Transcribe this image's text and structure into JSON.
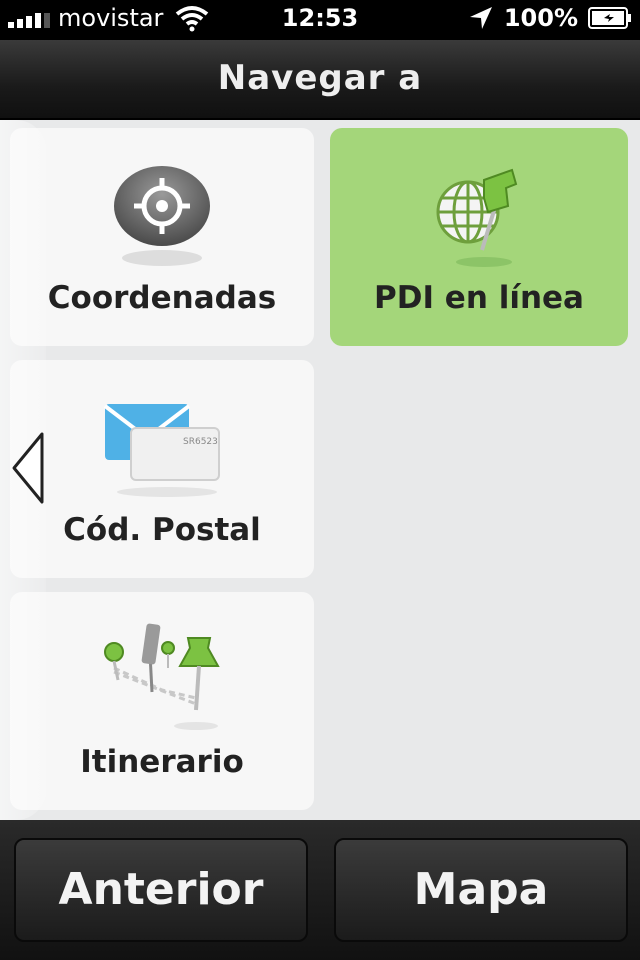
{
  "status_bar": {
    "carrier": "movistar",
    "time": "12:53",
    "battery": "100%"
  },
  "header": {
    "title": "Navegar a"
  },
  "tiles": [
    {
      "label": "Coordenadas",
      "icon": "crosshair-icon"
    },
    {
      "label": "PDI en línea",
      "icon": "globe-pin-icon",
      "selected": true
    },
    {
      "label": "Cód. Postal",
      "icon": "envelope-icon",
      "postcode_text": "SR6523"
    },
    {
      "label": "Itinerario",
      "icon": "route-pins-icon"
    }
  ],
  "bottom": {
    "back_label": "Anterior",
    "map_label": "Mapa"
  },
  "colors": {
    "selected_tile": "#a4d67a",
    "tile": "#f7f7f7",
    "background": "#e8e9ea"
  }
}
